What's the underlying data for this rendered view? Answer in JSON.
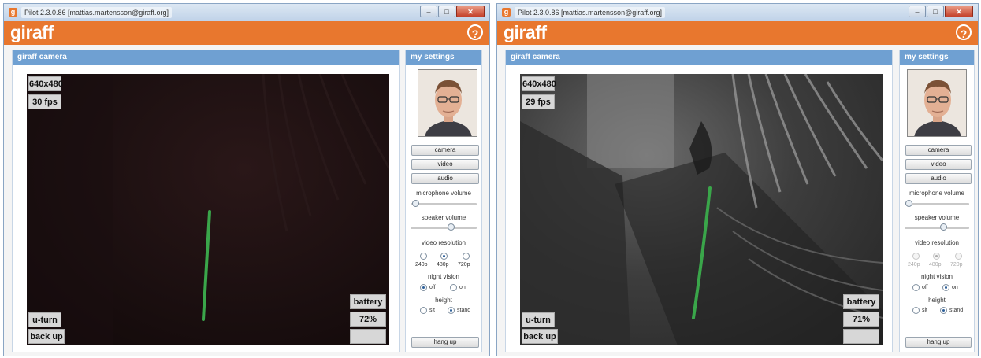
{
  "windows": [
    {
      "title": "Pilot 2.3.0.86 [mattias.martensson@giraff.org]",
      "logo": "giraff",
      "help_glyph": "?",
      "camera_panel_title": "giraff camera",
      "settings_panel_title": "my settings",
      "resolution_readout": "640x480",
      "fps_readout": "30 fps",
      "battery_label": "battery",
      "battery_value": "72%",
      "battery_level": 0.72,
      "uturn_label": "u-turn",
      "backup_label": "back up",
      "camera_button": "camera",
      "video_button": "video",
      "audio_button": "audio",
      "mic_label": "microphone volume",
      "speaker_label": "speaker volume",
      "mic_level": 0.02,
      "speaker_level": 0.62,
      "resolution_label": "video resolution",
      "res_options": [
        "240p",
        "480p",
        "720p"
      ],
      "res_selected": "480p",
      "res_disabled": false,
      "night_label": "night vision",
      "night_options": [
        "off",
        "on"
      ],
      "night_selected": "off",
      "height_label": "height",
      "height_options": [
        "sit",
        "stand"
      ],
      "height_selected": "stand",
      "hangup_button": "hang up",
      "video_mode": "dark",
      "colors": {
        "accent": "#e8772e",
        "panel_header": "#6fa0d2",
        "path_line": "#3aa64a"
      }
    },
    {
      "title": "Pilot 2.3.0.86 [mattias.martensson@giraff.org]",
      "logo": "giraff",
      "help_glyph": "?",
      "camera_panel_title": "giraff camera",
      "settings_panel_title": "my settings",
      "resolution_readout": "640x480",
      "fps_readout": "29 fps",
      "battery_label": "battery",
      "battery_value": "71%",
      "battery_level": 0.71,
      "uturn_label": "u-turn",
      "backup_label": "back up",
      "camera_button": "camera",
      "video_button": "video",
      "audio_button": "audio",
      "mic_label": "microphone volume",
      "speaker_label": "speaker volume",
      "mic_level": 0.02,
      "speaker_level": 0.62,
      "resolution_label": "video resolution",
      "res_options": [
        "240p",
        "480p",
        "720p"
      ],
      "res_selected": "480p",
      "res_disabled": true,
      "night_label": "night vision",
      "night_options": [
        "off",
        "on"
      ],
      "night_selected": "on",
      "height_label": "height",
      "height_options": [
        "sit",
        "stand"
      ],
      "height_selected": "stand",
      "hangup_button": "hang up",
      "video_mode": "night",
      "colors": {
        "accent": "#e8772e",
        "panel_header": "#6fa0d2",
        "path_line": "#3aa64a"
      }
    }
  ]
}
